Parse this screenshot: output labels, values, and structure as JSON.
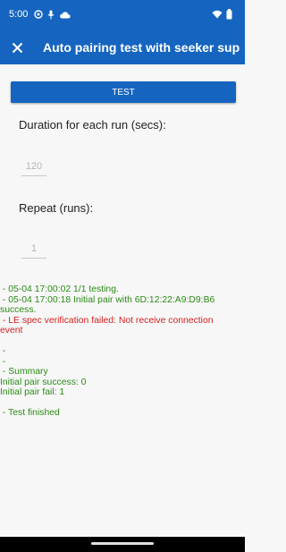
{
  "status_bar": {
    "time": "5:00",
    "icons": [
      "settings-gear-icon",
      "microphone-icon",
      "cloud-icon"
    ],
    "right_icons": [
      "wifi-icon",
      "battery-icon"
    ],
    "color": "#1565c0"
  },
  "app_bar": {
    "close_icon": "close-icon",
    "title": "Auto pairing test with seeker sup..."
  },
  "test_button": {
    "label": "TEST"
  },
  "duration": {
    "label": "Duration for each run (secs):",
    "placeholder": "120"
  },
  "repeat": {
    "label": "Repeat (runs):",
    "placeholder": "1"
  },
  "log": {
    "lines": [
      {
        "text": " - 05-04 17:00:02 1/1 testing.",
        "color": "green"
      },
      {
        "text": " - 05-04 17:00:18 Initial pair with 6D:12:22:A9:D9:B6",
        "color": "green"
      },
      {
        "text": "success.",
        "color": "green"
      },
      {
        "text": " - LE spec verification failed: Not receive connection",
        "color": "red"
      },
      {
        "text": "event",
        "color": "red"
      },
      {
        "text": "",
        "color": "green"
      },
      {
        "text": " -",
        "color": "green"
      },
      {
        "text": " -",
        "color": "green"
      },
      {
        "text": " - Summary",
        "color": "green"
      },
      {
        "text": "Initial pair success: 0",
        "color": "green"
      },
      {
        "text": "Initial pair fail: 1",
        "color": "green"
      },
      {
        "text": "",
        "color": "green"
      },
      {
        "text": " - Test finished",
        "color": "green"
      }
    ]
  }
}
